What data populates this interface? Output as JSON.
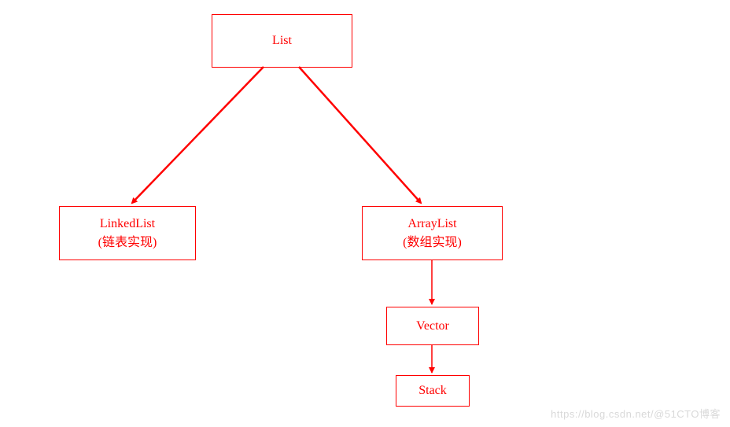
{
  "nodes": {
    "list": {
      "label": "List"
    },
    "linkedlist": {
      "line1": "LinkedList",
      "line2": "(链表实现)"
    },
    "arraylist": {
      "line1": "ArrayList",
      "line2": "(数组实现)"
    },
    "vector": {
      "label": "Vector"
    },
    "stack": {
      "label": "Stack"
    }
  },
  "watermark": "https://blog.csdn.net/@51CTO博客",
  "colors": {
    "stroke": "#ff0000"
  }
}
